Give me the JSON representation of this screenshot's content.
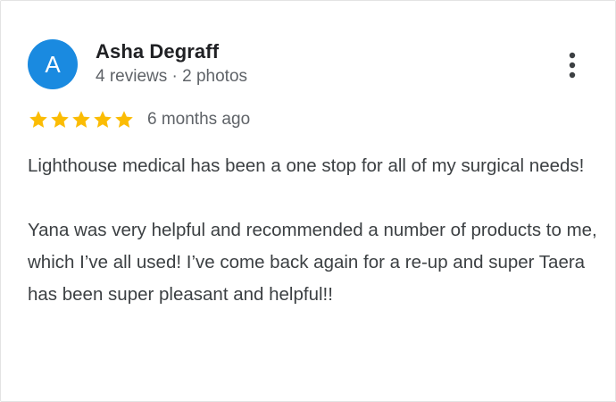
{
  "reviewer": {
    "avatar_letter": "A",
    "avatar_color": "#1a8ae0",
    "name": "Asha Degraff",
    "meta": "4 reviews · 2 photos"
  },
  "menu_icon": "more-vert-icon",
  "rating": {
    "stars": 5,
    "max_stars": 5,
    "star_color": "#fbbc04",
    "time": "6 months ago"
  },
  "review": {
    "paragraph_1": "Lighthouse medical has been a one stop for all of my surgical needs!",
    "paragraph_2": "Yana was very helpful and recommended a number of products to me, which I’ve all used! I’ve come back again for a re-up and super Taera has been super pleasant and helpful!!"
  }
}
